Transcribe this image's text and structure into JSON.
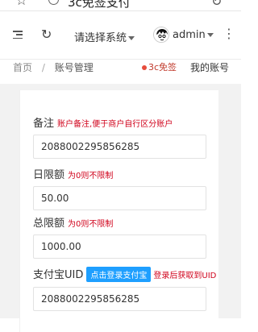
{
  "browser": {
    "url": "3c免签支付"
  },
  "header": {
    "system_select": "请选择系统",
    "username": "admin"
  },
  "breadcrumb": {
    "home": "首页",
    "separator": "/",
    "current": "账号管理"
  },
  "tabs": {
    "brand": "3c免签",
    "account": "我的账号"
  },
  "form": {
    "note": {
      "label": "备注",
      "hint": "账户备注,便于商户自行区分账户",
      "value": "2088002295856285"
    },
    "daily_limit": {
      "label": "日限额",
      "hint": "为0则不限制",
      "value": "50.00"
    },
    "total_limit": {
      "label": "总限额",
      "hint": "为0则不限制",
      "value": "1000.00"
    },
    "alipay_uid": {
      "label": "支付宝UID",
      "button": "点击登录支付宝",
      "hint": "登录后获取到UID",
      "value": "2088002295856285"
    }
  },
  "colors": {
    "hint_red": "#d0021b",
    "button_blue": "#1e9fff",
    "page_bg": "#f2f2f2"
  }
}
